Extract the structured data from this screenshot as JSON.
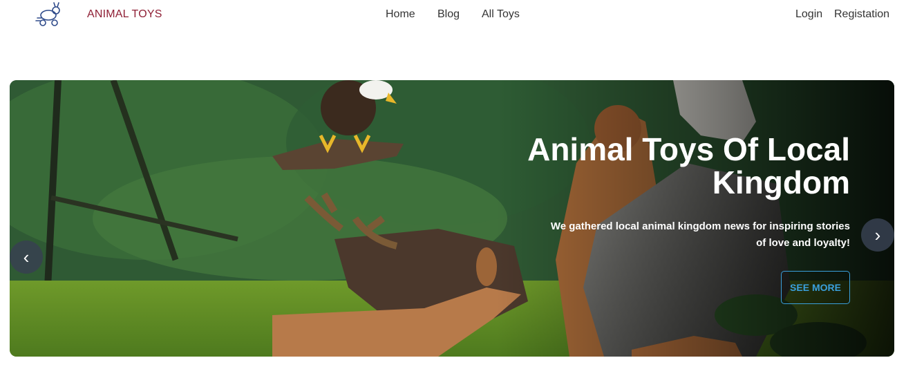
{
  "nav": {
    "brand": "ANIMAL TOYS",
    "logo_icon": "rabbit-logo-icon",
    "links": {
      "home": "Home",
      "blog": "Blog",
      "all_toys": "All Toys"
    },
    "auth": {
      "login": "Login",
      "registration": "Registation"
    }
  },
  "hero": {
    "title": "Animal Toys Of Local Kingdom",
    "subtitle": "We gathered local animal kingdom news for inspiring stories of love and loyalty!",
    "button_label": "SEE MORE",
    "prev_label": "‹",
    "next_label": "›"
  },
  "colors": {
    "brand": "#8f1f35",
    "accent": "#3aa0dc",
    "arrow_bg": "#374151"
  }
}
